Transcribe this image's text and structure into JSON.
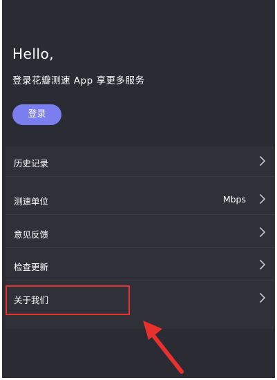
{
  "header": {
    "greeting": "Hello,",
    "subtitle": "登录花瓣测速 App 享更多服务",
    "login_label": "登录"
  },
  "menu": {
    "items": [
      {
        "label": "历史记录",
        "value": "",
        "icon": "chevron-right-icon"
      },
      {
        "label": "测速单位",
        "value": "Mbps",
        "icon": "chevron-right-icon"
      },
      {
        "label": "意见反馈",
        "value": "",
        "icon": "chevron-right-icon"
      },
      {
        "label": "检查更新",
        "value": "",
        "icon": "chevron-right-icon"
      },
      {
        "label": "关于我们",
        "value": "",
        "icon": "chevron-right-icon"
      }
    ]
  },
  "annotation": {
    "highlight_color": "#e8302f",
    "highlighted_item": "关于我们"
  },
  "colors": {
    "background": "#2a2b33",
    "panel": "#303138",
    "accent": "#7b7eef"
  }
}
